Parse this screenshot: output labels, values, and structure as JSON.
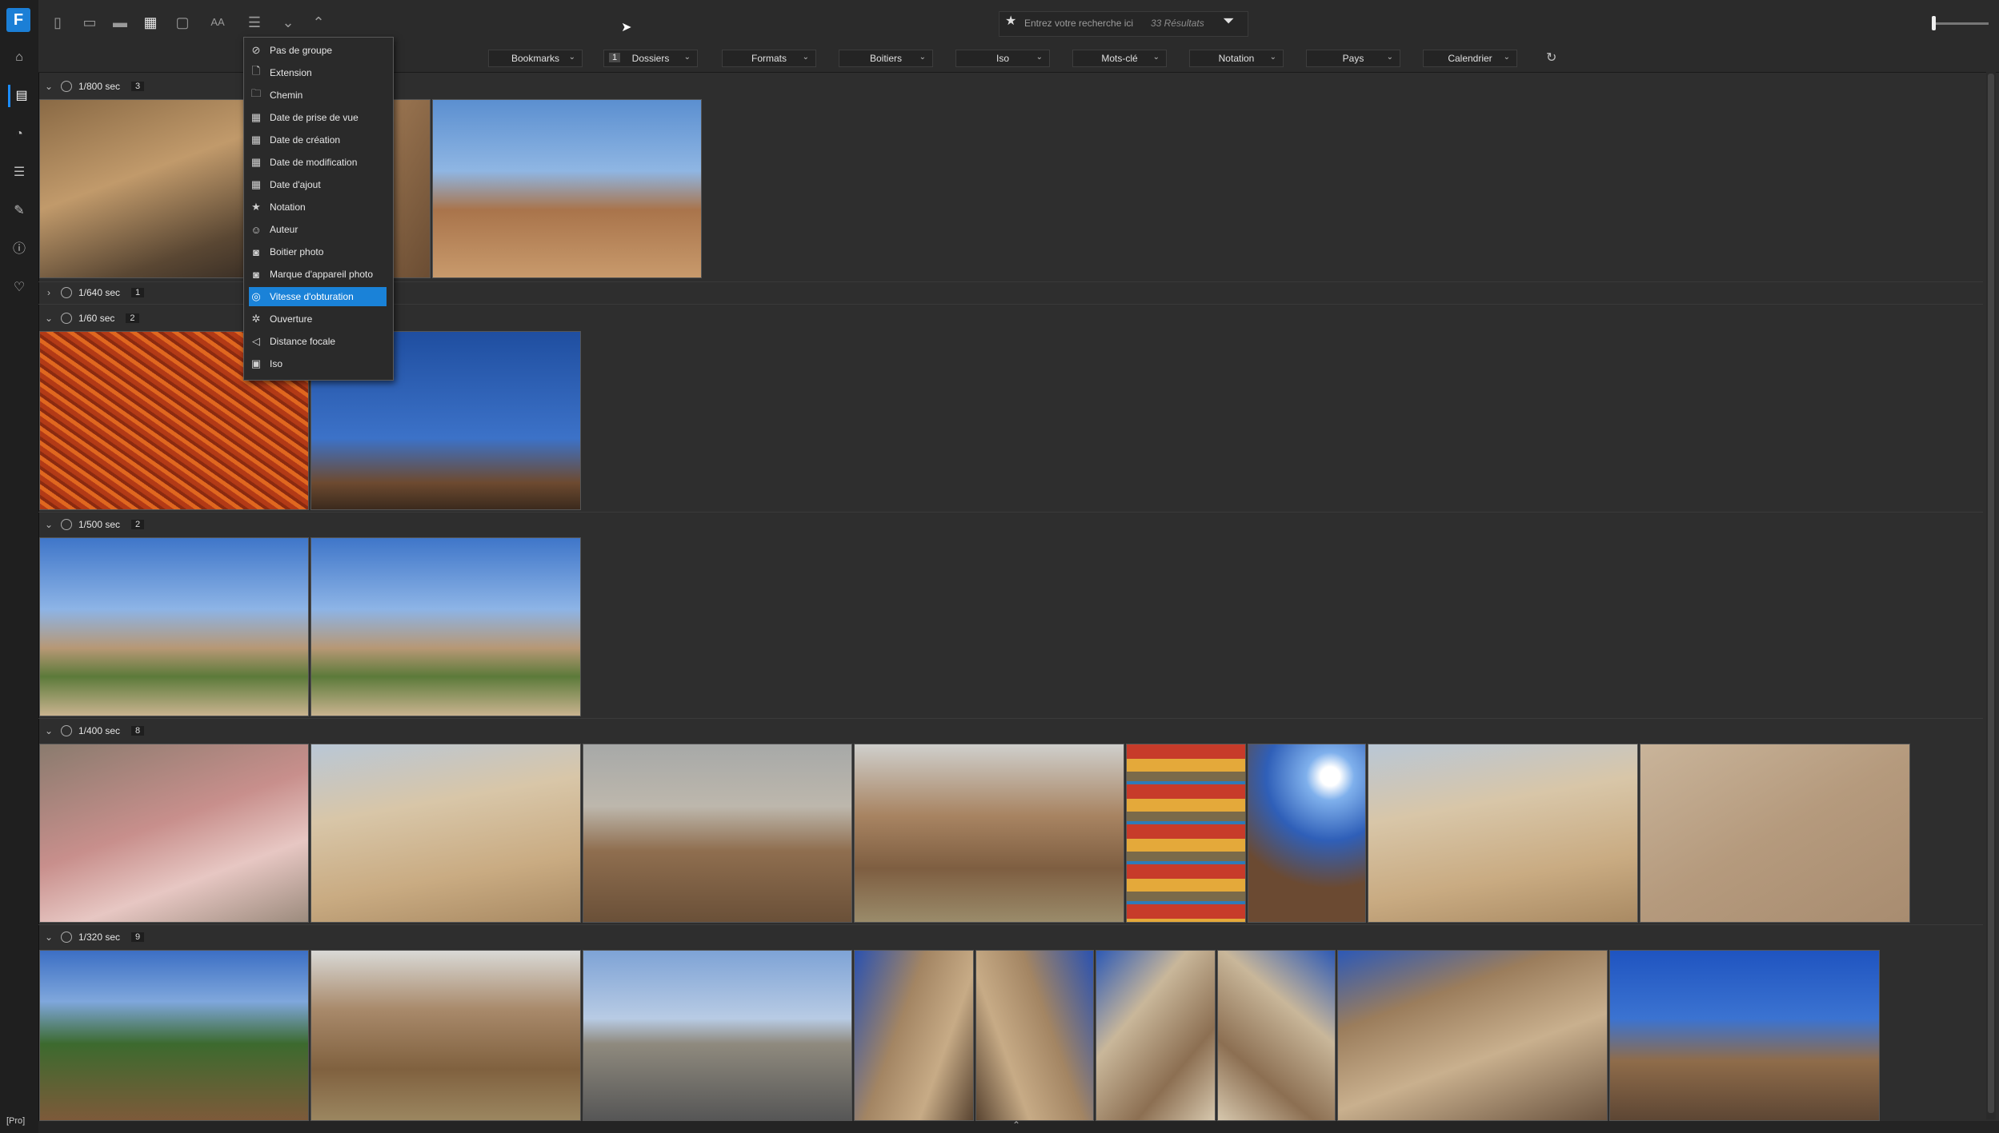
{
  "rail": {
    "logo": "F",
    "items": [
      {
        "name": "home-icon",
        "glyph": "⌂"
      },
      {
        "name": "library-icon",
        "glyph": "▤"
      },
      {
        "name": "stats-icon",
        "glyph": "◔"
      },
      {
        "name": "adjust-icon",
        "glyph": "☰"
      },
      {
        "name": "edit-icon",
        "glyph": "✎"
      },
      {
        "name": "info-icon",
        "glyph": "ⓘ"
      },
      {
        "name": "tips-icon",
        "glyph": "♡"
      }
    ],
    "pro_label": "[Pro]"
  },
  "toolbar": {
    "search_placeholder": "Entrez votre recherche ici",
    "result_count": "33 Résultats",
    "star": "★",
    "filter_glyph": "⏷"
  },
  "filters": {
    "chips": [
      {
        "label": "Bookmarks"
      },
      {
        "label": "Dossiers",
        "count": "1"
      },
      {
        "label": "Formats"
      },
      {
        "label": "Boitiers"
      },
      {
        "label": "Iso"
      },
      {
        "label": "Mots-clé"
      },
      {
        "label": "Notation"
      },
      {
        "label": "Pays"
      },
      {
        "label": "Calendrier"
      }
    ],
    "refresh_glyph": "↻"
  },
  "groups": [
    {
      "label": "1/800 sec",
      "count": "3",
      "expanded": true
    },
    {
      "label": "1/640 sec",
      "count": "1",
      "expanded": false
    },
    {
      "label": "1/60 sec",
      "count": "2",
      "expanded": true
    },
    {
      "label": "1/500 sec",
      "count": "2",
      "expanded": true
    },
    {
      "label": "1/400 sec",
      "count": "8",
      "expanded": true
    },
    {
      "label": "1/320 sec",
      "count": "9",
      "expanded": true
    }
  ],
  "menu": {
    "items": [
      {
        "label": "Pas de groupe",
        "icon": "⊘"
      },
      {
        "label": "Extension",
        "icon": "🗋"
      },
      {
        "label": "Chemin",
        "icon": "🗀"
      },
      {
        "label": "Date de prise de vue",
        "icon": "▦"
      },
      {
        "label": "Date de création",
        "icon": "▦"
      },
      {
        "label": "Date de modification",
        "icon": "▦"
      },
      {
        "label": "Date d'ajout",
        "icon": "▦"
      },
      {
        "label": "Notation",
        "icon": "★"
      },
      {
        "label": "Auteur",
        "icon": "☺"
      },
      {
        "label": "Boitier photo",
        "icon": "◙"
      },
      {
        "label": "Marque d'appareil photo",
        "icon": "◙"
      },
      {
        "label": "Vitesse d'obturation",
        "icon": "◎"
      },
      {
        "label": "Ouverture",
        "icon": "✲"
      },
      {
        "label": "Distance focale",
        "icon": "◁"
      },
      {
        "label": "Iso",
        "icon": "▣"
      }
    ],
    "selected_index": 11
  },
  "colors": {
    "accent": "#1a82d8",
    "background": "#2e2e2e"
  }
}
